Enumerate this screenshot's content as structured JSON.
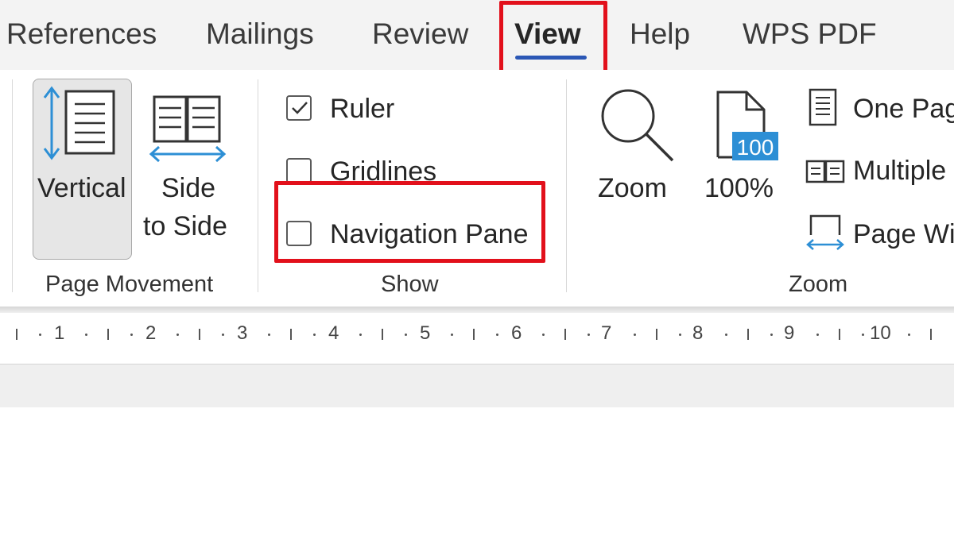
{
  "tabs": [
    {
      "label": "References"
    },
    {
      "label": "Mailings"
    },
    {
      "label": "Review"
    },
    {
      "label": "View"
    },
    {
      "label": "Help"
    },
    {
      "label": "WPS PDF"
    }
  ],
  "ribbon": {
    "page_movement": {
      "vertical_label": "Vertical",
      "side_line1": "Side",
      "side_line2": "to Side",
      "group_label": "Page Movement"
    },
    "show": {
      "ruler_label": "Ruler",
      "gridlines_label": "Gridlines",
      "navigation_pane_label": "Navigation Pane",
      "group_label": "Show"
    },
    "zoom": {
      "zoom_label": "Zoom",
      "hundred_label": "100%",
      "hundred_badge": "100",
      "one_page_label": "One Pag",
      "multiple_label": "Multiple",
      "page_width_label": "Page Wi",
      "group_label": "Zoom"
    }
  },
  "ruler": {
    "numbers": [
      "1",
      "2",
      "3",
      "4",
      "5",
      "6",
      "7",
      "8",
      "9",
      "10"
    ]
  },
  "colors": {
    "highlight": "#e2101b",
    "accent_blue": "#2b57b5",
    "icon_blue": "#2d8fd5"
  }
}
